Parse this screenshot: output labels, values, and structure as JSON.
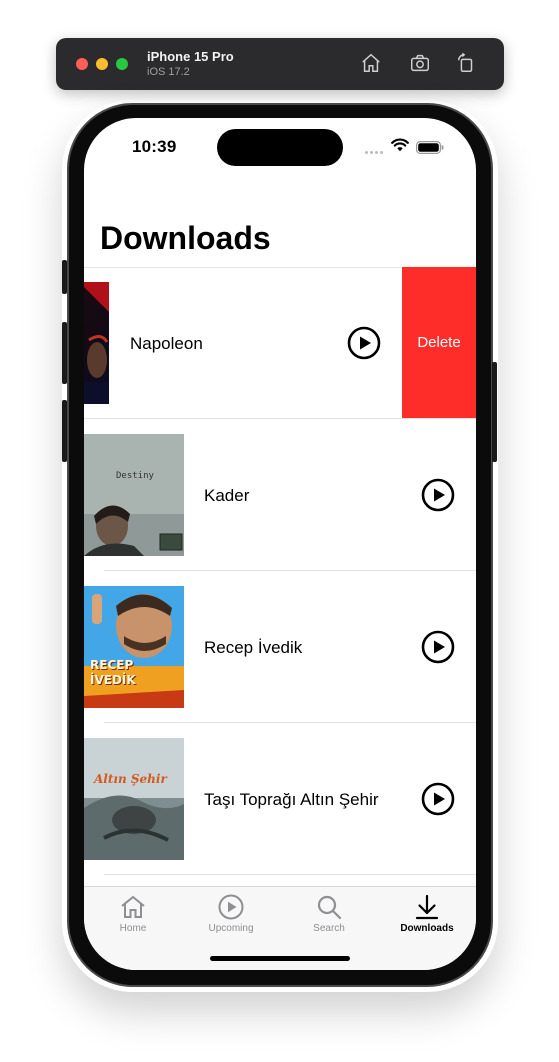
{
  "simulator": {
    "device_name": "iPhone 15 Pro",
    "os_version": "iOS 17.2",
    "buttons": [
      "home-icon",
      "screenshot-icon",
      "rotate-icon"
    ]
  },
  "status_bar": {
    "time": "10:39"
  },
  "page": {
    "title": "Downloads"
  },
  "downloads": [
    {
      "title": "Napoleon",
      "delete_label": "Delete",
      "poster_text": ""
    },
    {
      "title": "Kader",
      "poster_text": "Destiny"
    },
    {
      "title": "Recep İvedik",
      "poster_text": "RECEP İVEDİK"
    },
    {
      "title": "Taşı Toprağı Altın Şehir",
      "poster_text": "Altın Şehir"
    }
  ],
  "tab_bar": {
    "tabs": [
      {
        "label": "Home",
        "icon": "house-icon",
        "selected": false
      },
      {
        "label": "Upcoming",
        "icon": "play-circle-icon",
        "selected": false
      },
      {
        "label": "Search",
        "icon": "magnifying-glass-icon",
        "selected": false
      },
      {
        "label": "Downloads",
        "icon": "arrow-down-icon",
        "selected": true
      }
    ]
  },
  "colors": {
    "delete": "#ff2d2a",
    "active_tab": "#000000",
    "inactive_tab": "#8e8e93"
  }
}
